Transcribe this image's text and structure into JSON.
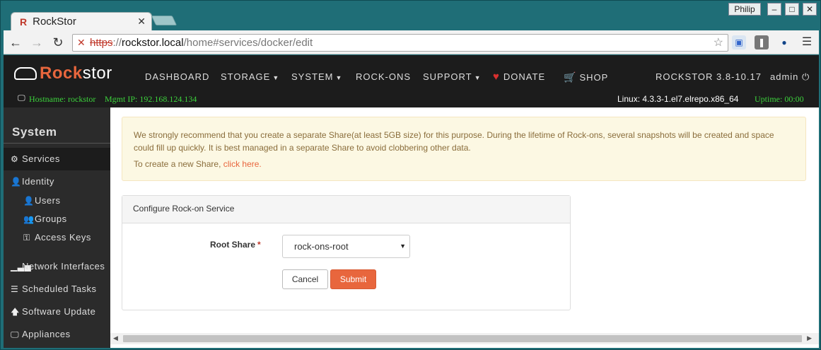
{
  "browser": {
    "tab_title": "RockStor",
    "tab_favicon": "R",
    "profile": "Philip",
    "url_scheme": "https",
    "url_host": "rockstor.local",
    "url_path": "/home#services/docker/edit"
  },
  "navbar": {
    "brand_rock": "Rock",
    "brand_stor": "stor",
    "items": [
      "DASHBOARD",
      "STORAGE",
      "SYSTEM",
      "ROCK-ONS",
      "SUPPORT",
      "DONATE",
      "SHOP"
    ],
    "version": "ROCKSTOR 3.8-10.17",
    "user": "admin"
  },
  "statusbar": {
    "hostname": "Hostname: rockstor",
    "mgmt_ip": "Mgmt IP: 192.168.124.134",
    "kernel": "Linux: 4.3.3-1.el7.elrepo.x86_64",
    "uptime": "Uptime: 00:00"
  },
  "sidebar": {
    "title": "System",
    "items": [
      "Services",
      "Identity",
      "Users",
      "Groups",
      "Access Keys",
      "Network Interfaces",
      "Scheduled Tasks",
      "Software Update",
      "Appliances"
    ]
  },
  "alert": {
    "text1": "We strongly recommend that you create a separate Share(at least 5GB size) for this purpose. During the lifetime of Rock-ons, several snapshots will be created and space could fill up quickly. It is best managed in a separate Share to avoid clobbering other data.",
    "text2_prefix": "To create a new Share, ",
    "text2_link": "click here."
  },
  "panel": {
    "heading": "Configure Rock-on Service",
    "root_share_label": "Root Share",
    "required_mark": "*",
    "root_share_value": "rock-ons-root",
    "cancel_label": "Cancel",
    "submit_label": "Submit"
  },
  "colors": {
    "accent": "#e8663d",
    "navbar_bg": "#1c1c1c",
    "status_green": "#3cd23c",
    "alert_bg": "#fcf8e3",
    "alert_text": "#8a6d3b"
  }
}
